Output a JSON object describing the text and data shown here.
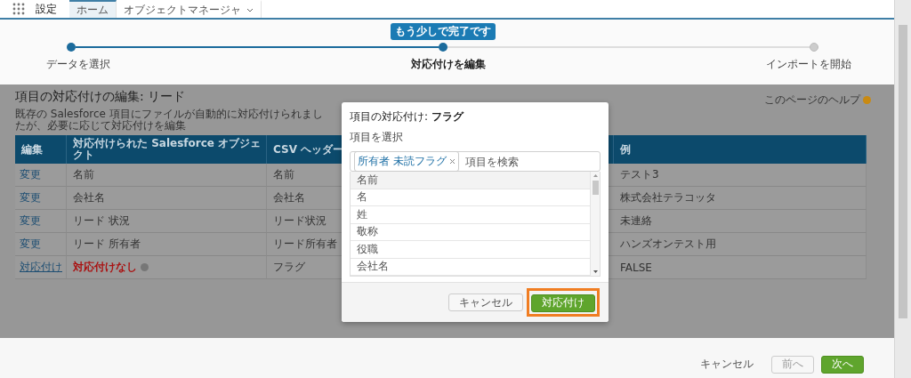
{
  "nav": {
    "title": "設定",
    "tabs": [
      {
        "label": "ホーム",
        "selected": true,
        "menu": false
      },
      {
        "label": "オブジェクトマネージャ",
        "selected": false,
        "menu": true
      }
    ]
  },
  "progress": {
    "tooltip": "もう少しで完了です",
    "level": 0.5,
    "steps": [
      {
        "label": "データを選択",
        "done": true,
        "selected": false
      },
      {
        "label": "対応付けを編集",
        "done": true,
        "selected": true
      },
      {
        "label": "インポートを開始",
        "done": false,
        "selected": false
      }
    ]
  },
  "page": {
    "title": "項目の対応付けの編集: リード",
    "description": "既存の Salesforce 項目にファイルが自動的に対応付けられましたが、必要に応じて対応付けを編集",
    "help": "このページのヘルプ"
  },
  "table": {
    "columns": [
      "編集",
      "対応付けられた Salesforce オブジェクト",
      "CSV ヘッダー",
      "例"
    ],
    "rows": [
      {
        "action": "変更",
        "kind": "mapped",
        "object": "名前",
        "csv": "名前",
        "example": "テスト3"
      },
      {
        "action": "変更",
        "kind": "mapped",
        "object": "会社名",
        "csv": "会社名",
        "example": "株式会社テラコッタ"
      },
      {
        "action": "変更",
        "kind": "mapped",
        "object": "リード 状況",
        "csv": "リード状況",
        "example": "未連絡"
      },
      {
        "action": "変更",
        "kind": "mapped",
        "object": "リード 所有者",
        "csv": "リード所有者",
        "example": "ハンズオンテスト用"
      },
      {
        "action": "対応付け",
        "kind": "unmapped",
        "object": "対応付けなし",
        "csv": "フラグ",
        "example": "FALSE"
      }
    ]
  },
  "modal": {
    "title": "項目の対応付け: **フラグ**",
    "field_label": "項目を選択",
    "pill": "所有者 未読フラグ",
    "placeholder": "項目を検索",
    "options": [
      {
        "label": "名前",
        "selected": true
      },
      {
        "label": "名",
        "selected": false
      },
      {
        "label": "姓",
        "selected": false
      },
      {
        "label": "敬称",
        "selected": false
      },
      {
        "label": "役職",
        "selected": false
      },
      {
        "label": "会社名",
        "selected": false
      }
    ],
    "cancel": "キャンセル",
    "confirm": "対応付け"
  },
  "footer": {
    "cancel": "キャンセル",
    "back": "前へ",
    "back_disabled": true,
    "next": "次へ"
  }
}
